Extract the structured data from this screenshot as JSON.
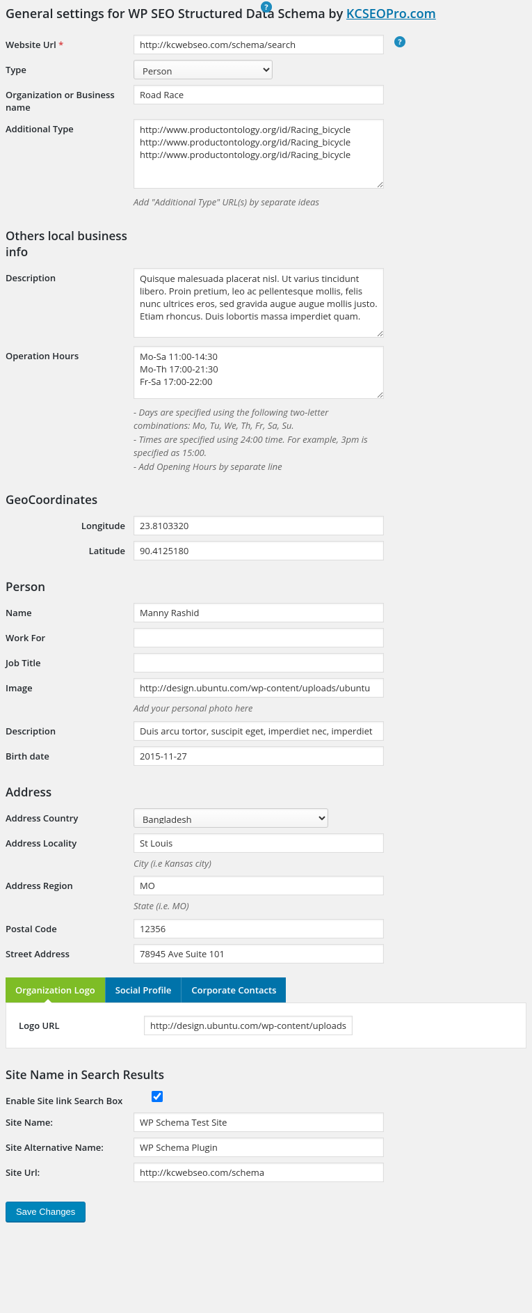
{
  "heading": {
    "prefix": "General settings for WP SEO Structured Data Schema by ",
    "link": "KCSEOPro.com"
  },
  "sections": {
    "others_local": "Others local business info",
    "geo": "GeoCoordinates",
    "person": "Person",
    "address": "Address",
    "sitename": "Site Name in Search Results"
  },
  "labels": {
    "website_url": "Website Url",
    "req": "*",
    "type": "Type",
    "org_name": "Organization or Business name",
    "additional_type": "Additional Type",
    "description": "Description",
    "operation_hours": "Operation Hours",
    "longitude": "Longitude",
    "latitude": "Latitude",
    "name": "Name",
    "work_for": "Work For",
    "job_title": "Job Title",
    "image": "Image",
    "birth_date": "Birth date",
    "addr_country": "Address Country",
    "addr_locality": "Address Locality",
    "addr_region": "Address Region",
    "postal_code": "Postal Code",
    "street": "Street Address",
    "logo_url": "Logo URL",
    "enable_sitelink": "Enable Site link Search Box",
    "site_name": "Site Name:",
    "site_alt": "Site Alternative Name:",
    "site_url": "Site Url:"
  },
  "values": {
    "website_url": "http://kcwebseo.com/schema/search",
    "type_selected": "Person",
    "org_name": "Road Race",
    "additional_type": "http://www.productontology.org/id/Racing_bicycle\nhttp://www.productontology.org/id/Racing_bicycle\nhttp://www.productontology.org/id/Racing_bicycle",
    "description_local": "Quisque malesuada placerat nisl. Ut varius tincidunt libero. Proin pretium, leo ac pellentesque mollis, felis nunc ultrices eros, sed gravida augue augue mollis justo. Etiam rhoncus. Duis lobortis massa imperdiet quam.",
    "operation_hours": "Mo-Sa 11:00-14:30\nMo-Th 17:00-21:30\nFr-Sa 17:00-22:00",
    "longitude": "23.8103320",
    "latitude": "90.4125180",
    "name": "Manny Rashid",
    "work_for": "",
    "job_title": "",
    "image": "http://design.ubuntu.com/wp-content/uploads/ubuntu",
    "description_person": "Duis arcu tortor, suscipit eget, imperdiet nec, imperdiet",
    "birth_date": "2015-11-27",
    "addr_country": "Bangladesh",
    "addr_locality": "St Louis",
    "addr_region": "MO",
    "postal_code": "12356",
    "street": "78945 Ave Suite 101",
    "logo_url": "http://design.ubuntu.com/wp-content/uploads/ubuntu",
    "enable_sitelink": true,
    "site_name": "WP Schema Test Site",
    "site_alt": "WP Schema Plugin",
    "site_url": "http://kcwebseo.com/schema"
  },
  "hints": {
    "additional_type": "Add \"Additional Type\" URL(s) by separate ideas",
    "image": "Add your personal photo here",
    "locality": "City (i.e Kansas city)",
    "region": "State (i.e. MO)"
  },
  "op_hints": {
    "l1": "- Days are specified using the following two-letter combinations: Mo, Tu, We, Th, Fr, Sa, Su.",
    "l2": "- Times are specified using 24:00 time. For example, 3pm is specified as 15:00.",
    "l3": "- Add Opening Hours by separate line"
  },
  "tabs": {
    "logo": "Organization Logo",
    "social": "Social Profile",
    "contacts": "Corporate Contacts"
  },
  "buttons": {
    "save": "Save Changes"
  },
  "help": "?"
}
